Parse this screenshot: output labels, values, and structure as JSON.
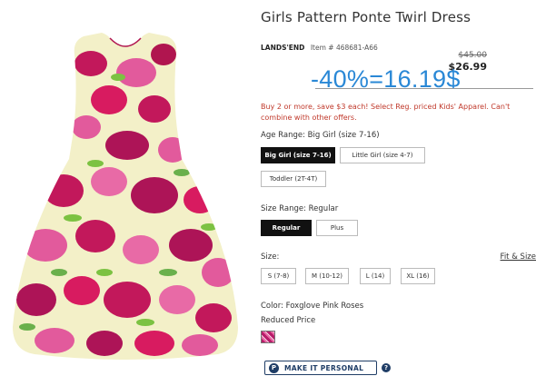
{
  "product": {
    "title": "Girls Pattern Ponte Twirl Dress",
    "brand": "LANDS'END",
    "item_number": "Item # 468681-A66",
    "original_price": "$45.00",
    "sale_price": "$26.99",
    "overlay_price_text": "-40%=16.19$",
    "promo_text": "Buy 2 or more, save $3 each! Select Reg. priced Kids' Apparel. Can't combine with other offers."
  },
  "age_range": {
    "label": "Age Range: Big Girl (size 7-16)",
    "options": [
      "Big Girl (size 7-16)",
      "Little Girl (size 4-7)",
      "Toddler (2T-4T)"
    ],
    "selected": "Big Girl (size 7-16)"
  },
  "size_range": {
    "label": "Size Range: Regular",
    "options": [
      "Regular",
      "Plus"
    ],
    "selected": "Regular"
  },
  "size": {
    "label": "Size:",
    "fit_link": "Fit & Size",
    "options": [
      "S (7-8)",
      "M (10-12)",
      "L (14)",
      "XL (16)"
    ]
  },
  "color": {
    "label": "Color: Foxglove Pink Roses",
    "note": "Reduced Price",
    "swatch_color": "#b81c6a"
  },
  "personalize": {
    "button_label": "MAKE IT PERSONAL",
    "icon_letter": "P",
    "help_glyph": "?"
  },
  "colors": {
    "overlay": "#2a88d6",
    "promo": "#c0392b",
    "button": "#1f3d66"
  }
}
